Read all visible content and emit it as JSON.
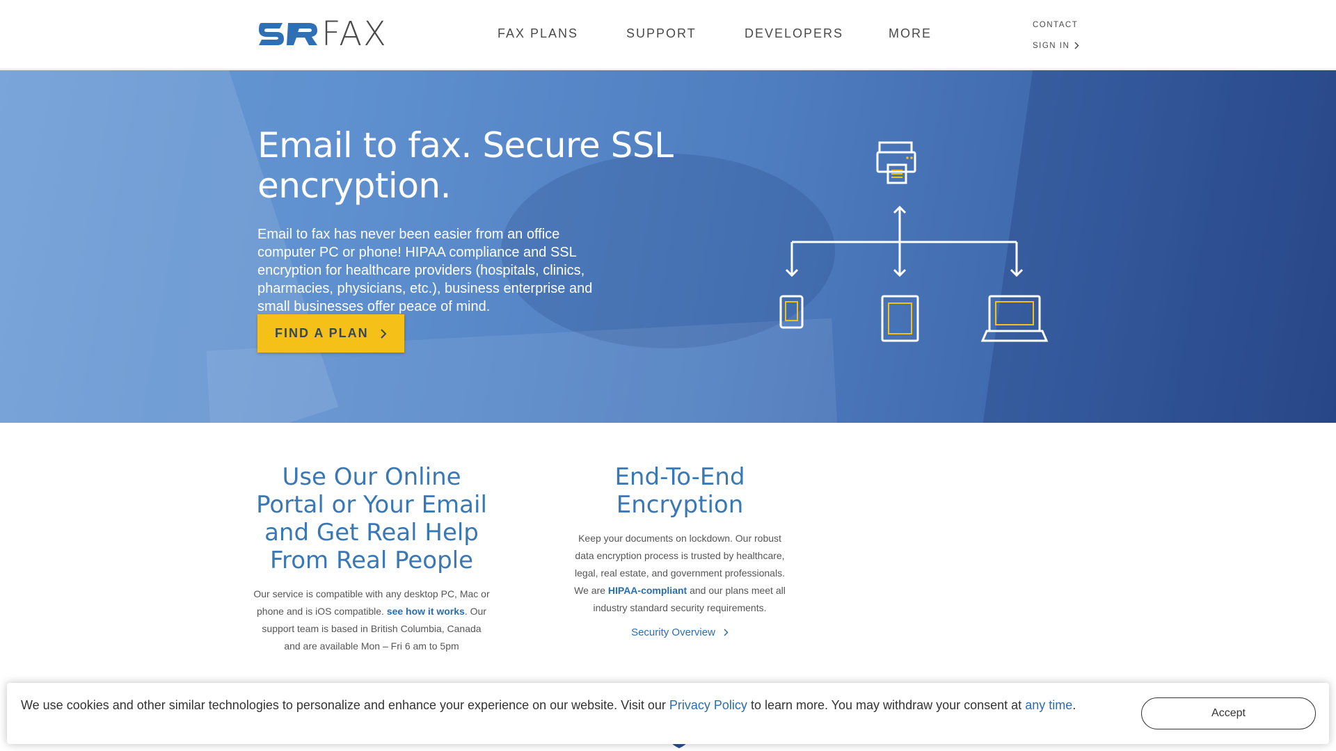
{
  "header": {
    "logo_text": "FAX",
    "logo_alt": "SRFAX",
    "nav": [
      {
        "label": "FAX PLANS"
      },
      {
        "label": "SUPPORT"
      },
      {
        "label": "DEVELOPERS"
      },
      {
        "label": "MORE"
      }
    ],
    "contact_label": "CONTACT",
    "signin_label": "SIGN IN"
  },
  "hero": {
    "title": "Email to fax. Secure SSL encryption.",
    "body": "Email to fax has never been easier from an office computer PC or phone! HIPAA compliance and SSL encryption for healthcare providers (hospitals, clinics, pharmacies, physicians, etc.), business enterprise and small businesses offer peace of mind.",
    "cta_label": "FIND A PLAN",
    "accent_color": "#f5c018",
    "diagram_icons": [
      "printer-icon",
      "phone-icon",
      "tablet-icon",
      "laptop-icon"
    ]
  },
  "features": {
    "portal": {
      "title": "Use Our Online Portal or Your Email and Get Real Help From Real People",
      "text_before_link": "Our service is compatible with any desktop PC, Mac or phone and is iOS compatible.",
      "link_label": "see how it works",
      "text_after_link": ". Our support team is based in British Columbia, Canada and are available Mon – Fri 6 am to 5pm"
    },
    "encryption": {
      "title": "End-To-End Encryption",
      "text_before_link": "Keep your documents on lockdown. Our robust data encryption process is trusted by healthcare, legal, real estate, and government professionals. We are",
      "link_label": "HIPAA-compliant",
      "text_after_link": "and our plans meet all industry standard security requirements.",
      "more_link": "Security Overview"
    }
  },
  "cookie": {
    "text_1": "We use cookies and other similar technologies to personalize and enhance your experience on our website. Visit our",
    "privacy_link": "Privacy Policy",
    "text_2": "to learn more. You may withdraw your consent at",
    "anytime_link": "any time",
    "text_3": ".",
    "accept_label": "Accept"
  },
  "colors": {
    "brand_blue": "#3a78b5",
    "link_blue": "#2a6db0",
    "hero_blue": "#4f7ec0"
  }
}
